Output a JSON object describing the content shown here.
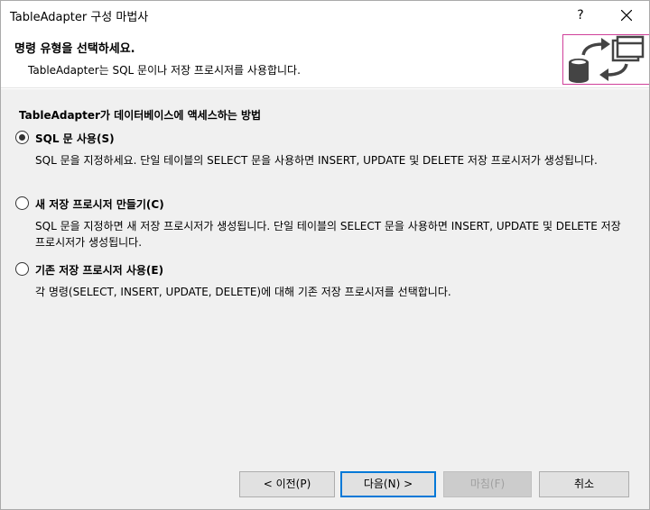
{
  "window": {
    "title": "TableAdapter 구성 마법사",
    "help_label": "?"
  },
  "header": {
    "heading": "명령 유형을 선택하세요.",
    "subheading": "TableAdapter는 SQL 문이나 저장 프로시저를 사용합니다."
  },
  "body": {
    "group_title": "TableAdapter가 데이터베이스에 액세스하는 방법",
    "options": [
      {
        "label": "SQL 문 사용(S)",
        "description": "SQL 문을 지정하세요. 단일 테이블의 SELECT 문을 사용하면 INSERT, UPDATE 및 DELETE 저장 프로시저가 생성됩니다.",
        "checked": true
      },
      {
        "label": "새 저장 프로시저 만들기(C)",
        "description": "SQL 문을 지정하면 새 저장 프로시저가 생성됩니다. 단일 테이블의 SELECT 문을 사용하면 INSERT, UPDATE 및 DELETE 저장 프로시저가 생성됩니다.",
        "checked": false
      },
      {
        "label": "기존 저장 프로시저 사용(E)",
        "description": "각 명령(SELECT, INSERT, UPDATE, DELETE)에 대해 기존 저장 프로시저를 선택합니다.",
        "checked": false
      }
    ]
  },
  "footer": {
    "prev_label": "< 이전(P)",
    "next_label": "다음(N) >",
    "finish_label": "마침(F)",
    "cancel_label": "취소"
  },
  "colors": {
    "accent": "#0078d7",
    "icon_frame": "#d0409a",
    "icon_dark": "#444444"
  },
  "icons": {
    "close": "close-icon",
    "wizard": "database-table-sync-icon"
  }
}
